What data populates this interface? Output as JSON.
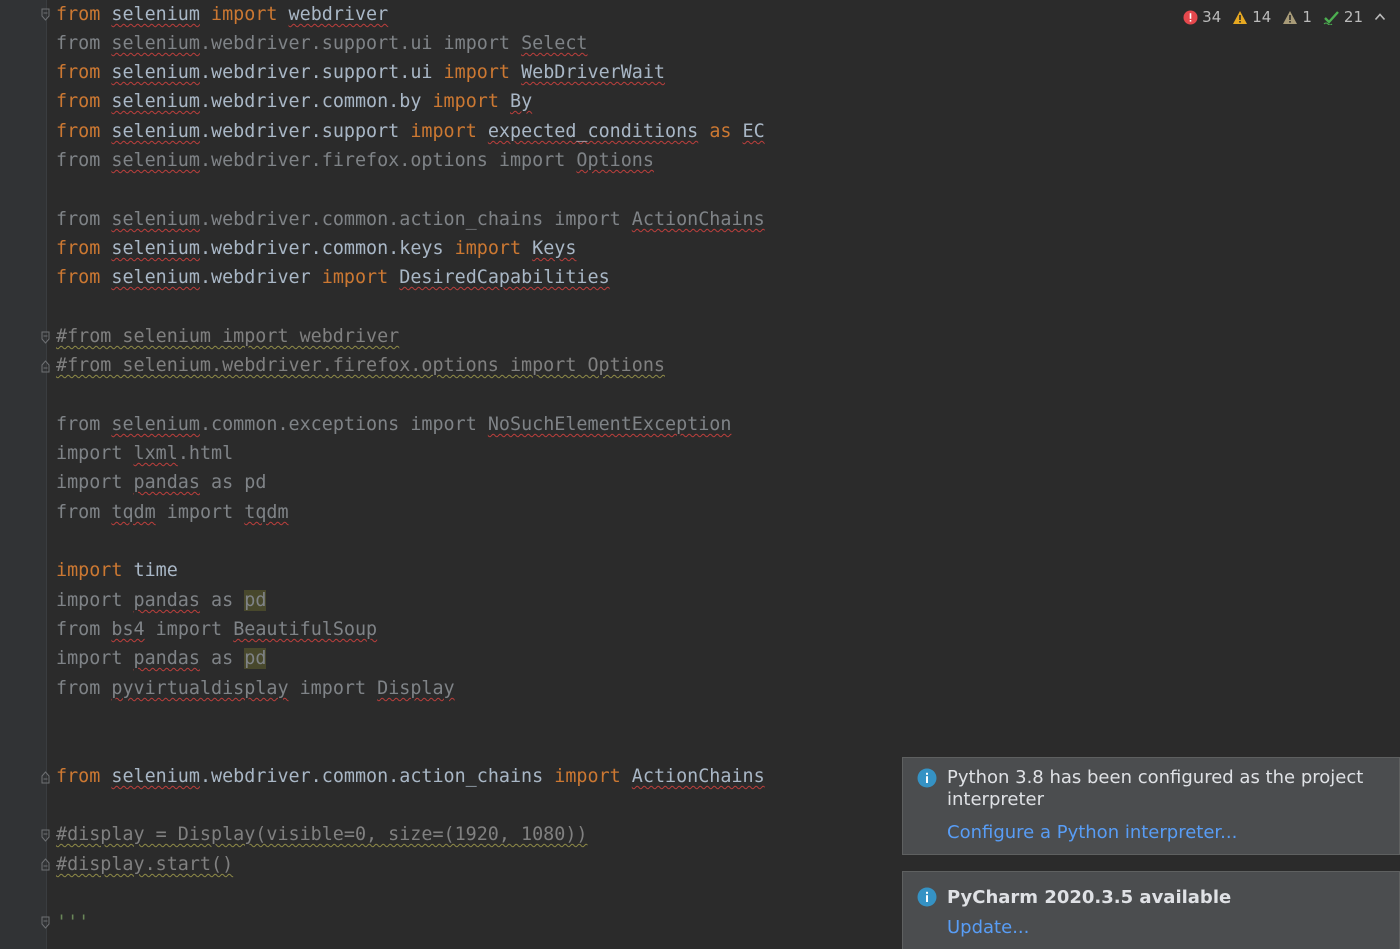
{
  "inspections": {
    "errors": "34",
    "warnings": "14",
    "weak_warnings": "1",
    "typos": "21"
  },
  "code": {
    "l1": {
      "a": "from",
      "b": "selenium",
      "c": "import",
      "d": "webdriver"
    },
    "l2": {
      "a": "from",
      "b": "selenium",
      "c": ".webdriver.support.ui",
      "d": "import",
      "e": "Select"
    },
    "l3": {
      "a": "from",
      "b": "selenium",
      "c": ".webdriver.support.ui",
      "d": "import",
      "e": "WebDriverWait"
    },
    "l4": {
      "a": "from",
      "b": "selenium",
      "c": ".webdriver.common.by",
      "d": "import",
      "e": "By"
    },
    "l5": {
      "a": "from",
      "b": "selenium",
      "c": ".webdriver.support",
      "d": "import",
      "e": "expected_conditions",
      "f": "as",
      "g": "EC"
    },
    "l6": {
      "a": "from",
      "b": "selenium",
      "c": ".webdriver.firefox.options",
      "d": "import",
      "e": "Options"
    },
    "l7": {
      "a": "from",
      "b": "selenium",
      "c": ".webdriver.common.action_chains",
      "d": "import",
      "e": "ActionChains"
    },
    "l8": {
      "a": "from",
      "b": "selenium",
      "c": ".webdriver.common.keys",
      "d": "import",
      "e": "Keys"
    },
    "l9": {
      "a": "from",
      "b": "selenium",
      "c": ".webdriver",
      "d": "import",
      "e": "DesiredCapabilities"
    },
    "l10": {
      "a": "#from selenium import webdriver"
    },
    "l11": {
      "a": "#from selenium.webdriver.firefox.options import Options"
    },
    "l12": {
      "a": "from",
      "b": "selenium",
      "c": ".common.exceptions",
      "d": "import",
      "e": "NoSuchElementException"
    },
    "l13": {
      "a": "import",
      "b": "lxml",
      "c": ".html"
    },
    "l14": {
      "a": "import",
      "b": "pandas",
      "c": "as",
      "d": "pd"
    },
    "l15": {
      "a": "from",
      "b": "tqdm",
      "c": "import",
      "d": "tqdm"
    },
    "l16": {
      "a": "import",
      "b": "time"
    },
    "l17": {
      "a": "import",
      "b": "pandas",
      "c": "as",
      "d": "pd"
    },
    "l18": {
      "a": "from",
      "b": "bs4",
      "c": "import",
      "d": "BeautifulSoup"
    },
    "l19": {
      "a": "import",
      "b": "pandas",
      "c": "as",
      "d": "pd"
    },
    "l20": {
      "a": "from",
      "b": "pyvirtualdisplay",
      "c": "import",
      "d": "Display"
    },
    "l21": {
      "a": "from",
      "b": "selenium",
      "c": ".webdriver.common.action_chains",
      "d": "import",
      "e": "ActionChains"
    },
    "l22": {
      "a": "#display = Display(visible=0, size=(1920, 1080))"
    },
    "l23": {
      "a": "#display.start()"
    },
    "l24": {
      "a": "'''"
    }
  },
  "notifications": {
    "interpreter": {
      "message": "Python 3.8 has been configured as the project interpreter",
      "link": "Configure a Python interpreter..."
    },
    "update": {
      "title": "PyCharm 2020.3.5 available",
      "link": "Update..."
    }
  },
  "colors": {
    "background": "#2b2b2b",
    "keyword": "#cc7832",
    "identifier": "#a9b7c6",
    "unused": "#7f8387",
    "link": "#589df6",
    "error": "#e5484d",
    "warning": "#e6a821",
    "typo_check": "#4caf50"
  }
}
